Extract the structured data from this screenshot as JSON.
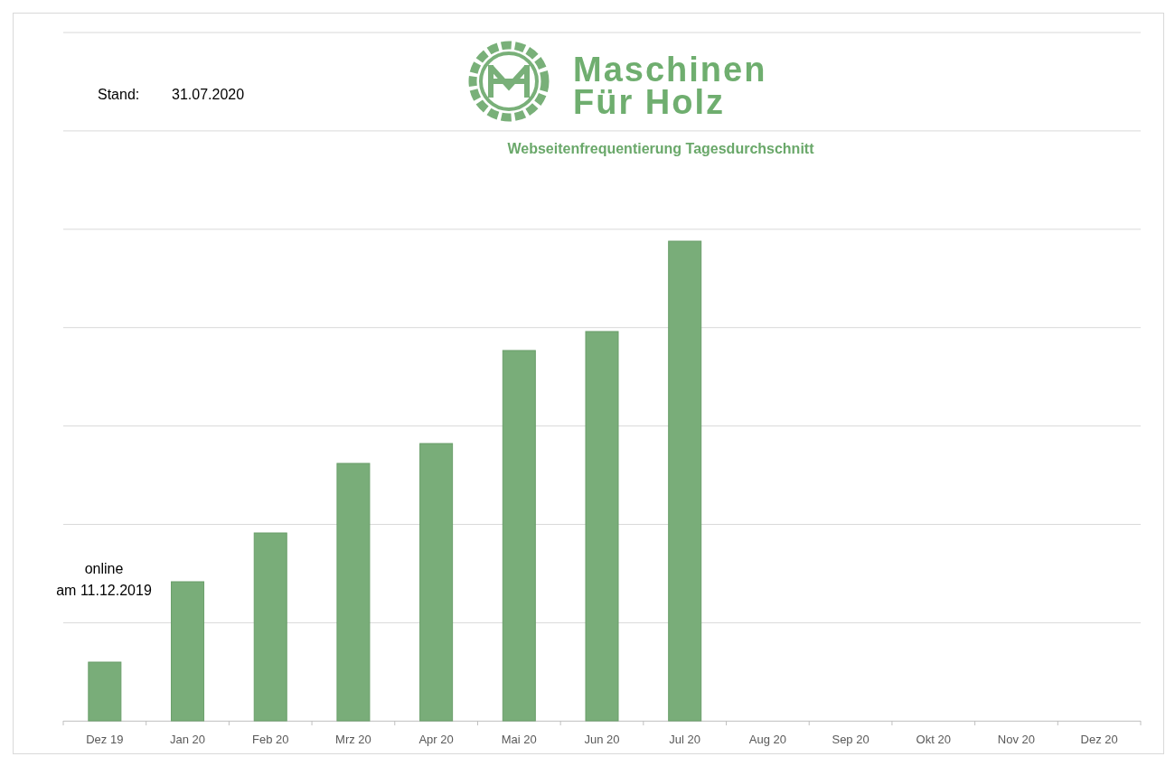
{
  "header": {
    "stand_label": "Stand:",
    "stand_date": "31.07.2020"
  },
  "logo": {
    "line_1": "Maschinen",
    "line_2": "Für Holz"
  },
  "chart": {
    "title": "Webseitenfrequentierung Tagesdurchschnitt",
    "annotation": [
      "online",
      "am 11.12.2019"
    ],
    "x_labels": [
      "Dez 19",
      "Jan 20",
      "Feb 20",
      "Mrz 20",
      "Apr 20",
      "Mai 20",
      "Jun 20",
      "Jul 20",
      "Aug 20",
      "Sep 20",
      "Okt 20",
      "Nov 20",
      "Dez 20"
    ]
  }
}
